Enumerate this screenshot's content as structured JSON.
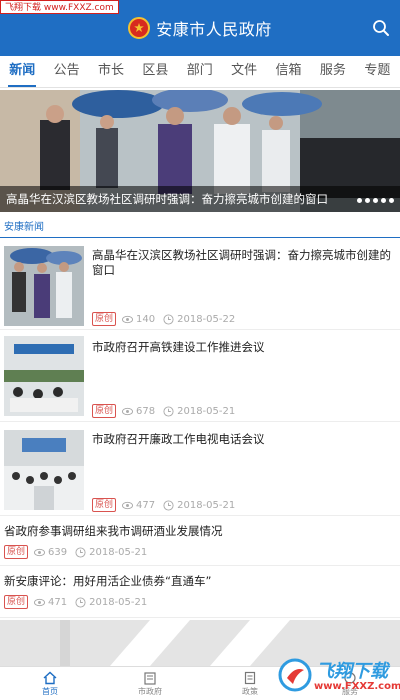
{
  "watermark": "飞翔下载 www.FXXZ.com",
  "header": {
    "title": "安康市人民政府"
  },
  "tabs": [
    {
      "label": "新闻",
      "active": true
    },
    {
      "label": "公告"
    },
    {
      "label": "市长"
    },
    {
      "label": "区县"
    },
    {
      "label": "部门"
    },
    {
      "label": "文件"
    },
    {
      "label": "信箱"
    },
    {
      "label": "服务"
    },
    {
      "label": "专题"
    }
  ],
  "banner": {
    "caption": "高晶华在汉滨区教场社区调研时强调：奋力擦亮城市创建的窗口"
  },
  "section": {
    "title": "安康新闻"
  },
  "news": [
    {
      "title": "高晶华在汉滨区教场社区调研时强调：奋力擦亮城市创建的窗口",
      "badge": "原创",
      "views": "140",
      "date": "2018-05-22"
    },
    {
      "title": "市政府召开高铁建设工作推进会议",
      "badge": "原创",
      "views": "678",
      "date": "2018-05-21"
    },
    {
      "title": "市政府召开廉政工作电视电话会议",
      "badge": "原创",
      "views": "477",
      "date": "2018-05-21"
    },
    {
      "title": "省政府参事调研组来我市调研酒业发展情况",
      "badge": "原创",
      "views": "639",
      "date": "2018-05-21"
    },
    {
      "title": "新安康评论：用好用活企业债券“直通车”",
      "badge": "原创",
      "views": "471",
      "date": "2018-05-21"
    }
  ],
  "bottom_nav": [
    {
      "label": "首页",
      "active": true
    },
    {
      "label": "市政府"
    },
    {
      "label": "政策"
    },
    {
      "label": "服务"
    }
  ],
  "logo": {
    "text": "飞翔下载",
    "sub": "www.FXXZ.com"
  },
  "colors": {
    "primary": "#1f6ec3",
    "badge": "#d9534f",
    "emblem": "#d72b1f"
  }
}
